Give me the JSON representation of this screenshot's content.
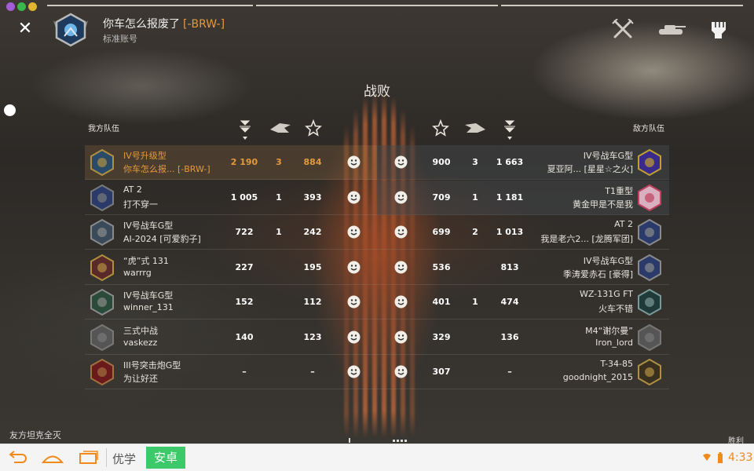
{
  "header": {
    "player_name": "你车怎么报废了",
    "clan_tag": "[-BRW-]",
    "account_type": "标准账号"
  },
  "result_title": "战败",
  "my_team_label": "我方队伍",
  "enemy_team_label": "敌方队伍",
  "rows": [
    {
      "left": {
        "tank": "IV号升级型",
        "player": "你车怎么报...  [-BRW-]",
        "damage": "2 190",
        "kills": "3",
        "xp": "884"
      },
      "right": {
        "tank": "IV号战车G型",
        "player": "夏亚阿...   [星星☆之火]",
        "xp": "900",
        "kills": "3",
        "damage": "1 663"
      }
    },
    {
      "left": {
        "tank": "AT 2",
        "player": "打不穿一",
        "damage": "1 005",
        "kills": "1",
        "xp": "393"
      },
      "right": {
        "tank": "T1重型",
        "player": "黄金甲是不是我",
        "xp": "709",
        "kills": "1",
        "damage": "1 181"
      }
    },
    {
      "left": {
        "tank": "IV号战车G型",
        "player": "AI-2024 [可爱豹子]",
        "damage": "722",
        "kills": "1",
        "xp": "242"
      },
      "right": {
        "tank": "AT 2",
        "player": "我是老六2...  [龙腾军团]",
        "xp": "699",
        "kills": "2",
        "damage": "1 013"
      }
    },
    {
      "left": {
        "tank": "“虎”式 131",
        "player": "warrrg",
        "damage": "227",
        "kills": "",
        "xp": "195"
      },
      "right": {
        "tank": "IV号战车G型",
        "player": "季涛爱赤石 [豪得]",
        "xp": "536",
        "kills": "",
        "damage": "813"
      }
    },
    {
      "left": {
        "tank": "IV号战车G型",
        "player": "winner_131",
        "damage": "152",
        "kills": "",
        "xp": "112"
      },
      "right": {
        "tank": "WZ-131G FT",
        "player": "火车不错",
        "xp": "401",
        "kills": "1",
        "damage": "474"
      }
    },
    {
      "left": {
        "tank": "三式中战",
        "player": "vaskezz",
        "damage": "140",
        "kills": "",
        "xp": "123"
      },
      "right": {
        "tank": "M4“谢尔曼”",
        "player": "Iron_lord",
        "xp": "329",
        "kills": "",
        "damage": "136"
      }
    },
    {
      "left": {
        "tank": "III号突击炮G型",
        "player": "为让好还",
        "damage": "–",
        "kills": "",
        "xp": "–"
      },
      "right": {
        "tank": "T-34-85",
        "player": "goodnight_2015",
        "xp": "307",
        "kills": "",
        "damage": "–"
      }
    }
  ],
  "footer": {
    "left_text": "友方坦克全灭",
    "right_text": "胜利"
  },
  "navbar": {
    "youxue": "优学",
    "anzhuo": "安卓",
    "time": "4:33"
  },
  "colors": {
    "accent": "#e59a3a",
    "android_green": "#3cc96a",
    "clock": "#f08a1c"
  }
}
